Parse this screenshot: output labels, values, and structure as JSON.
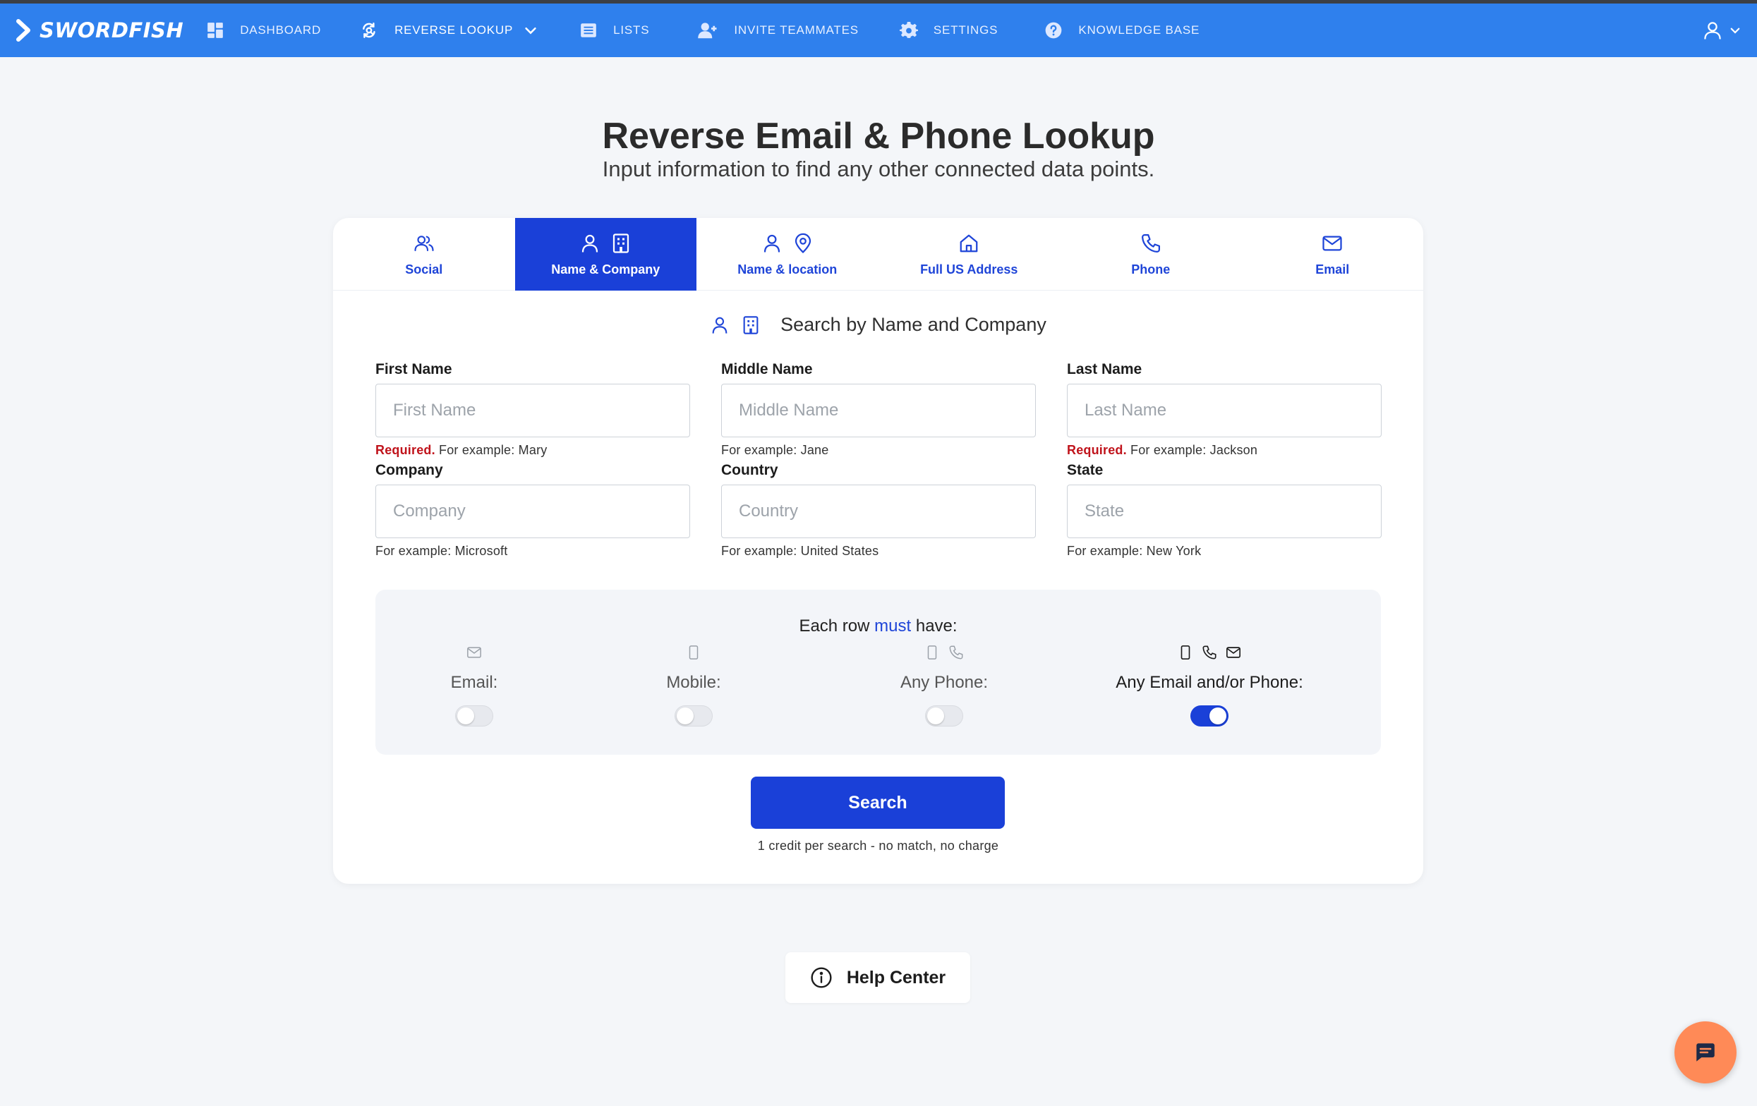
{
  "brand": {
    "name": "SWORDFISH"
  },
  "nav": {
    "items": [
      {
        "label": "DASHBOARD",
        "icon": "dashboard-icon"
      },
      {
        "label": "REVERSE LOOKUP",
        "icon": "reverse-lookup-icon",
        "active": true
      },
      {
        "label": "LISTS",
        "icon": "list-icon"
      },
      {
        "label": "INVITE TEAMMATES",
        "icon": "add-user-icon"
      },
      {
        "label": "SETTINGS",
        "icon": "gear-icon"
      },
      {
        "label": "KNOWLEDGE BASE",
        "icon": "question-circle-icon"
      }
    ],
    "user_menu_icon": "user-icon"
  },
  "page": {
    "title": "Reverse Email & Phone Lookup",
    "subtitle": "Input information to find any other connected data points."
  },
  "tabs": [
    {
      "label": "Social",
      "icons": [
        "users-icon"
      ]
    },
    {
      "label": "Name & Company",
      "icons": [
        "user-icon",
        "building-icon"
      ],
      "active": true
    },
    {
      "label": "Name & location",
      "icons": [
        "user-icon",
        "map-pin-icon"
      ]
    },
    {
      "label": "Full US Address",
      "icons": [
        "home-icon"
      ]
    },
    {
      "label": "Phone",
      "icons": [
        "phone-icon"
      ]
    },
    {
      "label": "Email",
      "icons": [
        "mail-icon"
      ]
    }
  ],
  "section": {
    "heading": "Search by Name and Company"
  },
  "form": {
    "first_name": {
      "label": "First Name",
      "placeholder": "First Name",
      "value": "",
      "required": "Required.",
      "hint": "For example: Mary"
    },
    "middle_name": {
      "label": "Middle Name",
      "placeholder": "Middle Name",
      "value": "",
      "hint": "For example: Jane"
    },
    "last_name": {
      "label": "Last Name",
      "placeholder": "Last Name",
      "value": "",
      "required": "Required.",
      "hint": "For example: Jackson"
    },
    "company": {
      "label": "Company",
      "placeholder": "Company",
      "value": "",
      "hint": "For example: Microsoft"
    },
    "country": {
      "label": "Country",
      "placeholder": "Country",
      "value": "",
      "hint": "For example: United States"
    },
    "state": {
      "label": "State",
      "placeholder": "State",
      "value": "",
      "hint": "For example: New York"
    }
  },
  "must_have": {
    "title_pre": "Each row",
    "title_highlight": "must",
    "title_post": "have:",
    "options": [
      {
        "label": "Email:",
        "icons": [
          "mail-icon"
        ],
        "enabled": false
      },
      {
        "label": "Mobile:",
        "icons": [
          "mobile-icon"
        ],
        "enabled": false
      },
      {
        "label": "Any Phone:",
        "icons": [
          "mobile-icon",
          "phone-icon"
        ],
        "enabled": false
      },
      {
        "label": "Any Email and/or Phone:",
        "icons": [
          "mobile-icon",
          "phone-icon",
          "mail-icon"
        ],
        "enabled": true
      }
    ]
  },
  "search_button": {
    "label": "Search"
  },
  "credit_note": "1 credit per search - no match, no charge",
  "help": {
    "label": "Help Center"
  },
  "chat": {
    "icon": "chat-icon"
  },
  "colors": {
    "nav_bg": "#2f80ed",
    "primary": "#1a40d8",
    "required": "#c0131b",
    "chat": "#ff8a57"
  }
}
